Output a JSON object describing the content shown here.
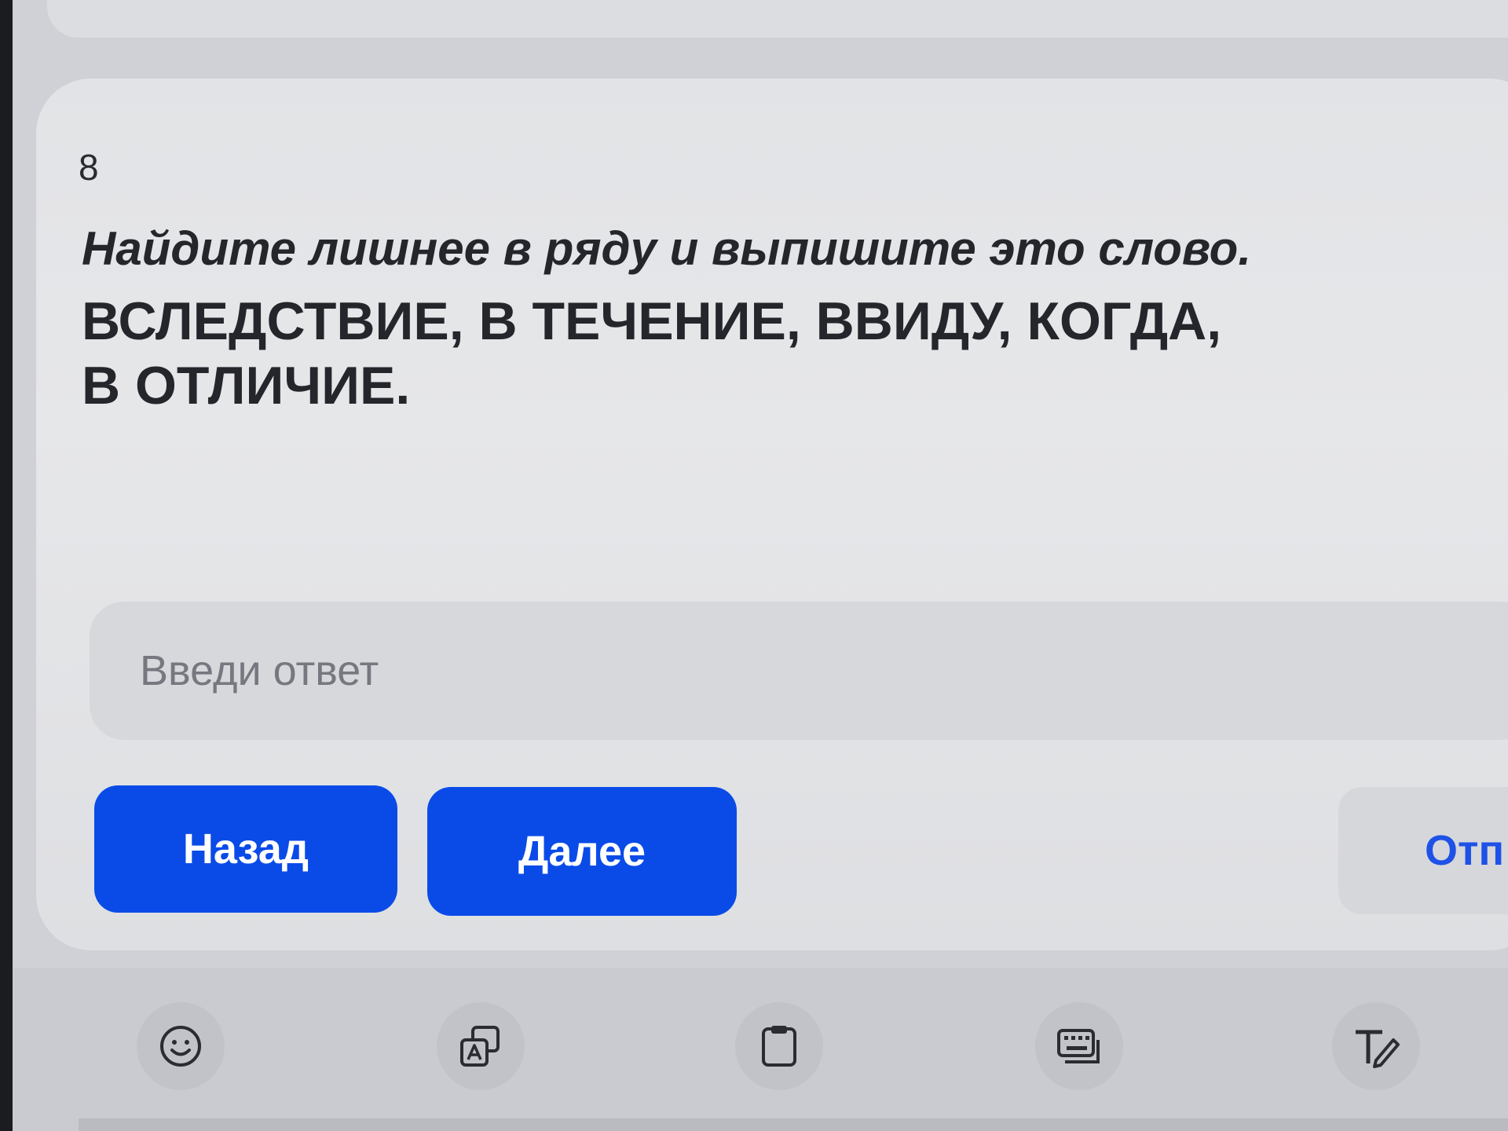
{
  "question": {
    "number": "8",
    "instruction": "Найдите лишнее в ряду и выпишите это слово.",
    "body": "ВСЛЕДСТВИЕ, В ТЕЧЕНИЕ, ВВИДУ, КОГДА, В ОТЛИЧИЕ."
  },
  "answer": {
    "placeholder": "Введи ответ",
    "value": ""
  },
  "buttons": {
    "back": "Назад",
    "next": "Далее",
    "submit": "Отп"
  },
  "colors": {
    "primary": "#0a4be8",
    "submit_text": "#1e52e6",
    "card": "#e4e5e8",
    "field": "#d7d8dc"
  },
  "keyboard_toolbar": {
    "items": [
      "emoji-icon",
      "translate-icon",
      "clipboard-icon",
      "keyboard-icon",
      "handwriting-icon"
    ]
  }
}
